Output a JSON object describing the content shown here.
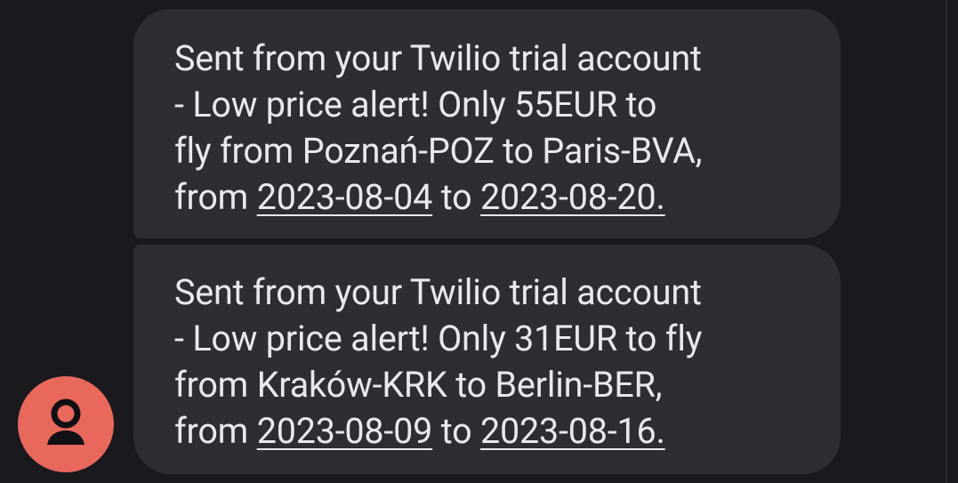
{
  "messages": [
    {
      "lines": [
        "Sent from your Twilio trial account",
        "- Low price alert! Only 55EUR to",
        "fly from Poznań-POZ to Paris-BVA,"
      ],
      "from_word": "from",
      "start_date": "2023-08-04",
      "to_word": "to",
      "end_date": "2023-08-20."
    },
    {
      "lines": [
        "Sent from your Twilio trial account",
        "- Low price alert! Only 31EUR to fly",
        "from Kraków-KRK to Berlin-BER,"
      ],
      "from_word": "from",
      "start_date": "2023-08-09",
      "to_word": "to",
      "end_date": "2023-08-16."
    }
  ],
  "avatar": {
    "icon": "person-icon",
    "color": "#e8695c"
  },
  "colors": {
    "background": "#1a191e",
    "bubble": "#2e2d33",
    "text": "#eae8ee"
  }
}
